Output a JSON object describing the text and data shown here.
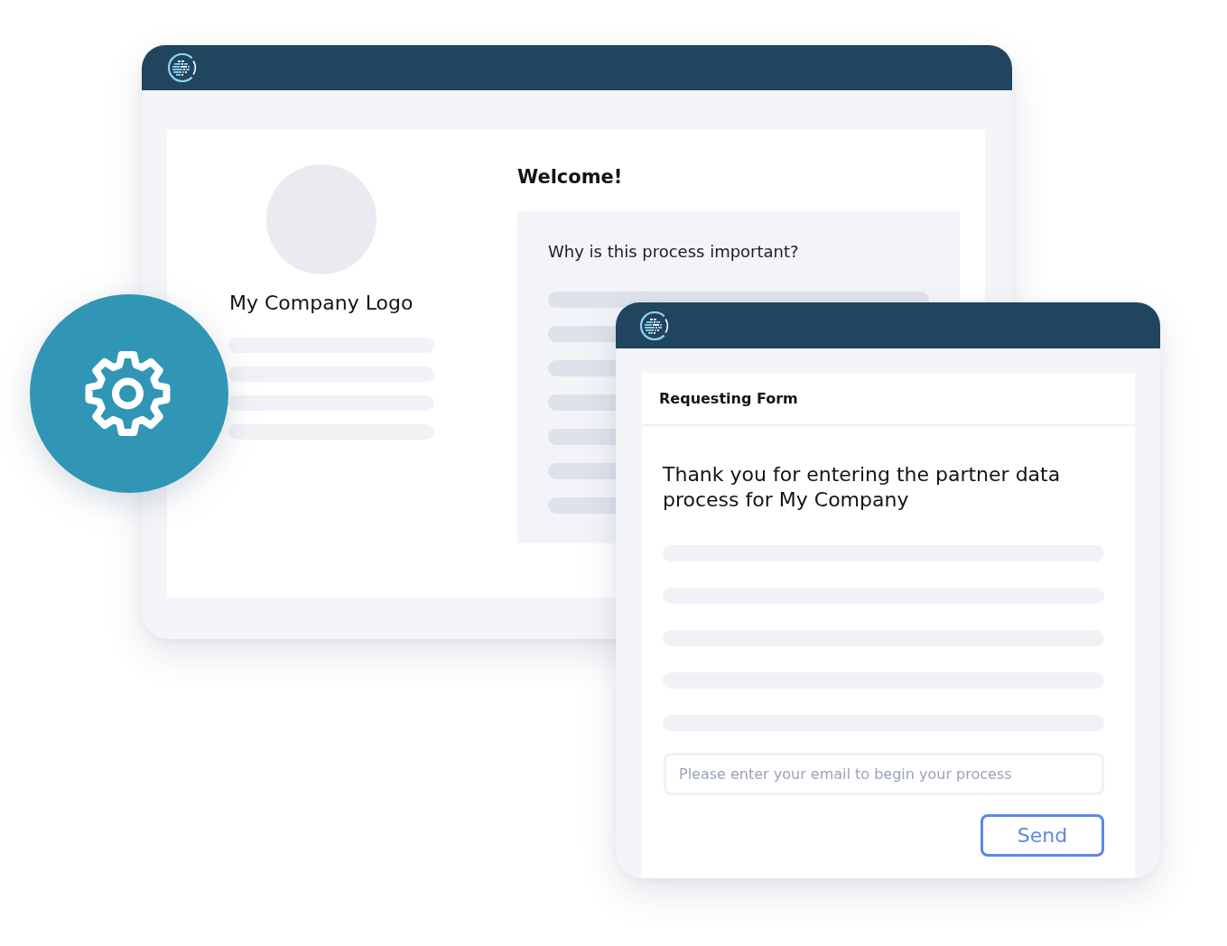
{
  "back_window": {
    "logo_label": "My Company Logo",
    "heading": "Welcome!",
    "card": {
      "title": "Why is this process important?"
    }
  },
  "form_window": {
    "title": "Requesting Form",
    "message": "Thank you for entering the partner data process for My Company",
    "email_field": {
      "placeholder": "Please enter your email to begin your process"
    },
    "buttons": [
      "Send"
    ]
  }
}
